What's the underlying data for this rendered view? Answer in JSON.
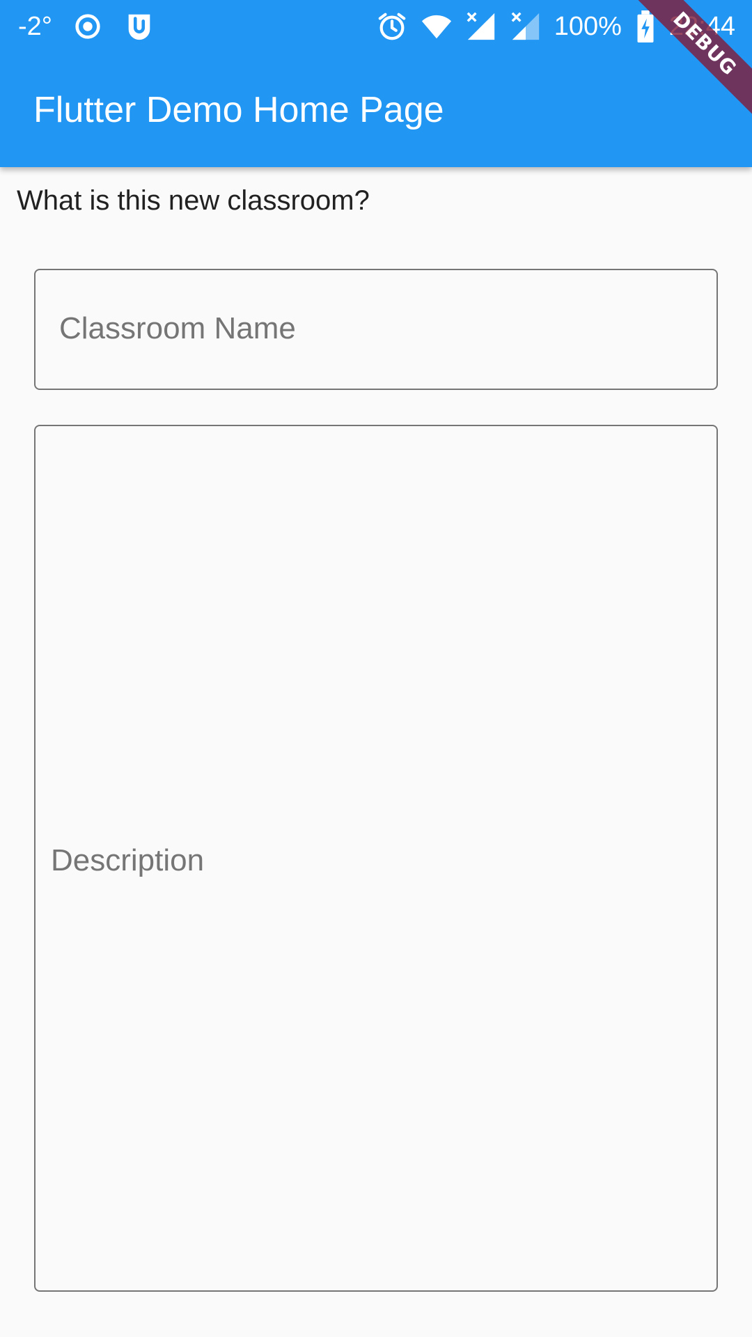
{
  "status_bar": {
    "temperature": "-2°",
    "battery_percent": "100%",
    "time": "22:44",
    "icons_left": [
      "location-target-icon",
      "app-notification-icon"
    ],
    "icons_right": [
      "alarm-icon",
      "wifi-icon",
      "cell-signal-1-icon",
      "cell-signal-2-icon",
      "battery-charging-icon"
    ]
  },
  "app_bar": {
    "title": "Flutter Demo Home Page",
    "color": "#2196f3"
  },
  "debug_banner": {
    "label": "DEBUG"
  },
  "form": {
    "prompt": "What is this new classroom?",
    "name_field": {
      "value": "",
      "placeholder": "Classroom Name"
    },
    "description_field": {
      "value": "",
      "placeholder": "Description"
    }
  }
}
